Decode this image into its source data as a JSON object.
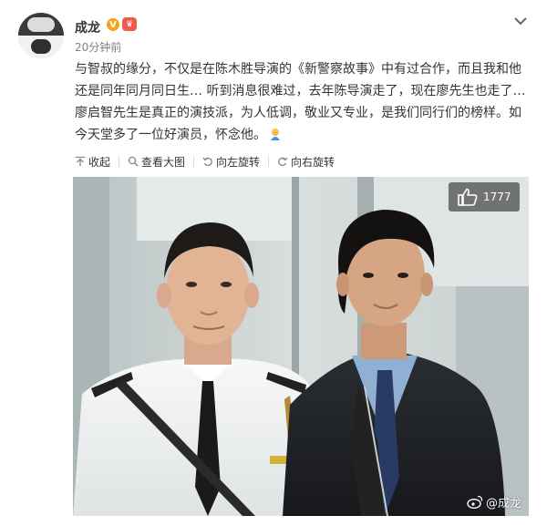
{
  "post": {
    "username": "成龙",
    "verified_badge": "V",
    "timestamp": "20分钟前",
    "lines": [
      "与智叔的缘分，不仅是在陈木胜导演的《新警察故事》中有过合作，而且我和他",
      "还是同年同月同日生… 听到消息很难过，去年陈导演走了，现在廖先生也走了…",
      "廖启智先生是真正的演技派，为人低调，敬业又专业，是我们同行们的榜样。如",
      "今天堂多了一位好演员，怀念他。"
    ]
  },
  "toolbar": {
    "collapse_label": "收起",
    "view_large_label": "查看大图",
    "rotate_left_label": "向左旋转",
    "rotate_right_label": "向右旋转"
  },
  "photo": {
    "like_count": "1777",
    "watermark": "@成龙"
  },
  "colors": {
    "vip_badge": "#f7a21b",
    "like_badge_bg": "rgba(70,70,70,0.72)",
    "text": "#333333",
    "muted": "#808080"
  },
  "icons": [
    "chevron-down-icon",
    "collapse-arrow-icon",
    "search-icon",
    "rotate-left-icon",
    "rotate-right-icon",
    "thumbs-up-icon",
    "weibo-logo-icon",
    "praying-emoji-icon"
  ]
}
